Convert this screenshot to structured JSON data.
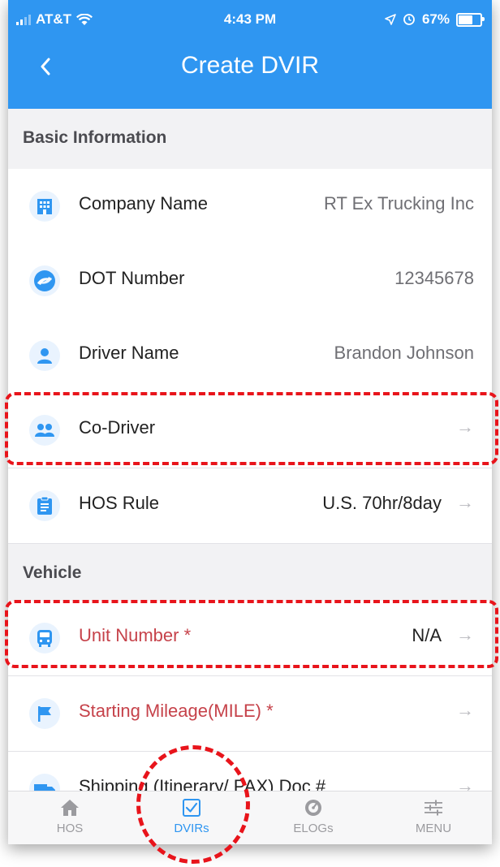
{
  "status_bar": {
    "carrier": "AT&T",
    "time": "4:43 PM",
    "battery": "67%",
    "signal_bars": 2
  },
  "nav": {
    "back_icon": "chevron-left-icon",
    "title": "Create DVIR"
  },
  "sections": {
    "basic": "Basic Information",
    "vehicle": "Vehicle"
  },
  "rows": {
    "company": {
      "icon": "building-icon",
      "label": "Company Name",
      "value": "RT Ex Trucking Inc"
    },
    "dot": {
      "icon": "dot-logo-icon",
      "label": "DOT Number",
      "value": "12345678"
    },
    "driver": {
      "icon": "person-icon",
      "label": "Driver Name",
      "value": "Brandon Johnson"
    },
    "codriver": {
      "icon": "people-icon",
      "label": "Co-Driver",
      "value": ""
    },
    "hos_rule": {
      "icon": "clipboard-icon",
      "label": "HOS Rule",
      "value": "U.S. 70hr/8day"
    },
    "unit": {
      "icon": "bus-icon",
      "label": "Unit Number *",
      "value": "N/A"
    },
    "mileage": {
      "icon": "flag-icon",
      "label": "Starting Mileage(MILE) *",
      "value": ""
    },
    "shipping": {
      "icon": "truck-icon",
      "label": "Shipping (Itinerary/ PAX) Doc #",
      "value": ""
    }
  },
  "arrow_glyph": "→",
  "tabs": [
    {
      "label": "HOS",
      "icon": "home-icon",
      "active": false
    },
    {
      "label": "DVIRs",
      "icon": "checkbox-icon",
      "active": true
    },
    {
      "label": "ELOGs",
      "icon": "dial-icon",
      "active": false
    },
    {
      "label": "MENU",
      "icon": "sliders-icon",
      "active": false
    }
  ],
  "colors": {
    "primary": "#2f96f1",
    "required_label": "#c6424a",
    "annotation": "#e8141b"
  }
}
